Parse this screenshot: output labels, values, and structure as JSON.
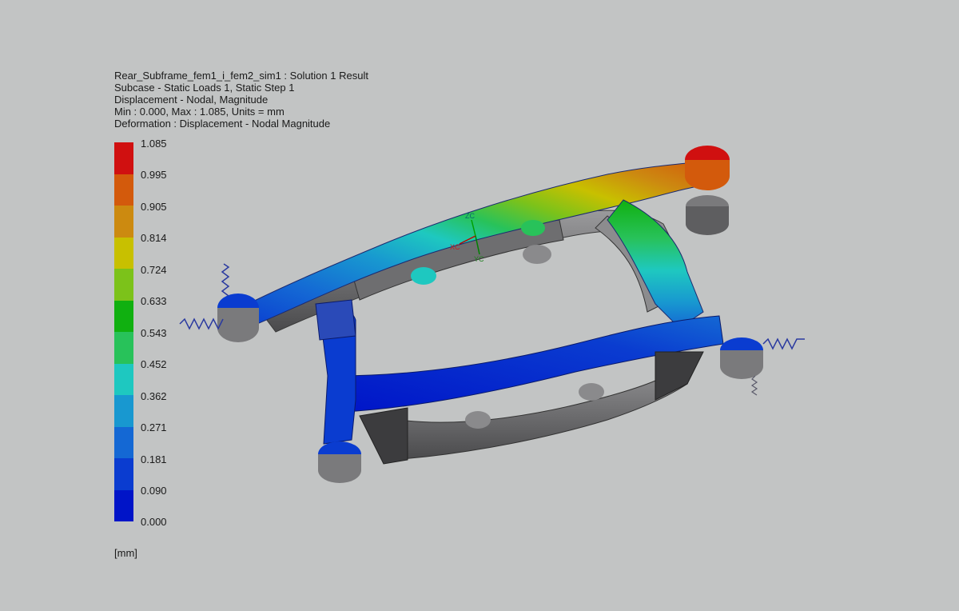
{
  "header": {
    "line1": "Rear_Subframe_fem1_i_fem2_sim1 : Solution 1 Result",
    "line2": "Subcase - Static Loads 1, Static Step 1",
    "line3": "Displacement - Nodal, Magnitude",
    "line4": "Min : 0.000, Max : 1.085, Units = mm",
    "line5": "Deformation : Displacement - Nodal Magnitude"
  },
  "legend": {
    "ticks": [
      "1.085",
      "0.995",
      "0.905",
      "0.814",
      "0.724",
      "0.633",
      "0.543",
      "0.452",
      "0.362",
      "0.271",
      "0.181",
      "0.090",
      "0.000"
    ],
    "colors": [
      "#d01010",
      "#d35a0c",
      "#cc8a10",
      "#c8c000",
      "#7cc21a",
      "#10b010",
      "#28c25a",
      "#1ec8c0",
      "#1898d0",
      "#1468d4",
      "#0a3cd0",
      "#0014c8"
    ],
    "units": "[mm]"
  },
  "triad": {
    "zc": "ZC",
    "xc": "XC",
    "yc": "YC"
  }
}
